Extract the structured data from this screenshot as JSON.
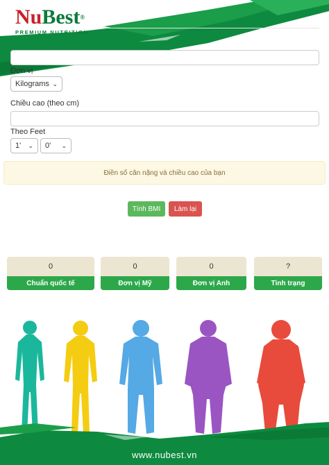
{
  "brand": {
    "name_part1": "Nu",
    "name_part2": "Best",
    "registered": "®",
    "tagline": "PREMIUM NUTRITION"
  },
  "form": {
    "weight_value": "",
    "unit_label": "Đơn vị",
    "unit_selected": "Kilograms",
    "height_label": "Chiều cao (theo cm)",
    "height_value": "",
    "feet_label": "Theo Feet",
    "feet_selected": "1'",
    "inches_selected": "0'",
    "hint": "Điền số cân nặng và chiều cao của bạn",
    "calc_button": "Tính BMI",
    "reset_button": "Làm lại"
  },
  "results": [
    {
      "value": "0",
      "label": "Chuẩn quốc tế"
    },
    {
      "value": "0",
      "label": "Đơn vị Mỹ"
    },
    {
      "value": "0",
      "label": "Đơn vị Anh"
    },
    {
      "value": "?",
      "label": "Tình trạng"
    }
  ],
  "figures": [
    {
      "color": "#1bb79c"
    },
    {
      "color": "#f4cc12"
    },
    {
      "color": "#55a9e4"
    },
    {
      "color": "#9a55c2"
    },
    {
      "color": "#e84b3c"
    }
  ],
  "colors": {
    "brand_green": "#0b7a3b",
    "brand_red": "#c8222a",
    "button_green": "#5cb85c",
    "button_red": "#d9534f",
    "card_green": "#2ca84a"
  },
  "footer": {
    "url": "www.nubest.vn"
  }
}
